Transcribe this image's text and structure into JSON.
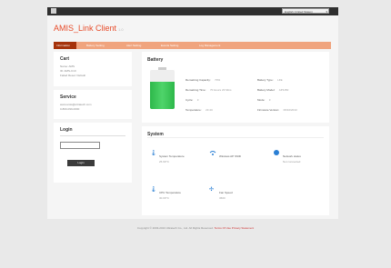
{
  "language_select": {
    "value": "English (United States)"
  },
  "header": {
    "title": "AMIS_Link Client",
    "version": "1.0"
  },
  "tabs": [
    {
      "label": "Information"
    },
    {
      "label": "Battery Setting"
    },
    {
      "label": "Alert Setting"
    },
    {
      "label": "Events Setting"
    },
    {
      "label": "Log Management"
    }
  ],
  "cart": {
    "title": "Cart",
    "lines": [
      "Name: AMS",
      "ID: AMS-C10",
      "Failed Reset: Default"
    ]
  },
  "service": {
    "title": "Service",
    "lines": [
      "www.amis@ultratech.com",
      "0-800-099-0000"
    ]
  },
  "login": {
    "title": "Login",
    "button": "Login"
  },
  "battery": {
    "title": "Battery",
    "level_percent": 70,
    "color": "#2db84a",
    "fields": [
      {
        "label": "Remaining Capacity:",
        "value": "70%"
      },
      {
        "label": "Remaining Time:",
        "value": "70 Hours 23 Mins"
      },
      {
        "label": "Cycle:",
        "value": "3"
      },
      {
        "label": "Temperature:",
        "value": "23.4C"
      }
    ],
    "fields_right": [
      {
        "label": "Battery Type:",
        "value": "LFE"
      },
      {
        "label": "Battery Model:",
        "value": "AP1150"
      },
      {
        "label": "Mode:",
        "value": "3"
      },
      {
        "label": "Firmware Version:",
        "value": "06/10/2013"
      }
    ]
  },
  "system": {
    "title": "System",
    "items": [
      {
        "icon": "thermometer-icon",
        "label": "System Temperature",
        "value": "25.99°C"
      },
      {
        "icon": "wifi-icon",
        "label": "Wireless AP SSID",
        "value": ""
      },
      {
        "icon": "network-icon",
        "label": "Network status",
        "value": "Not connected"
      },
      {
        "icon": "thermometer-icon",
        "label": "CPU Temperature",
        "value": "30.00°C"
      },
      {
        "icon": "fan-icon",
        "label": "Fan Speed",
        "value": "3600"
      }
    ]
  },
  "footer": {
    "text": "Copyright © 2003-2013 Ultratech Co., Ltd. All Rights Reserved.",
    "links": "Terms Of Use  Privacy Statement"
  }
}
